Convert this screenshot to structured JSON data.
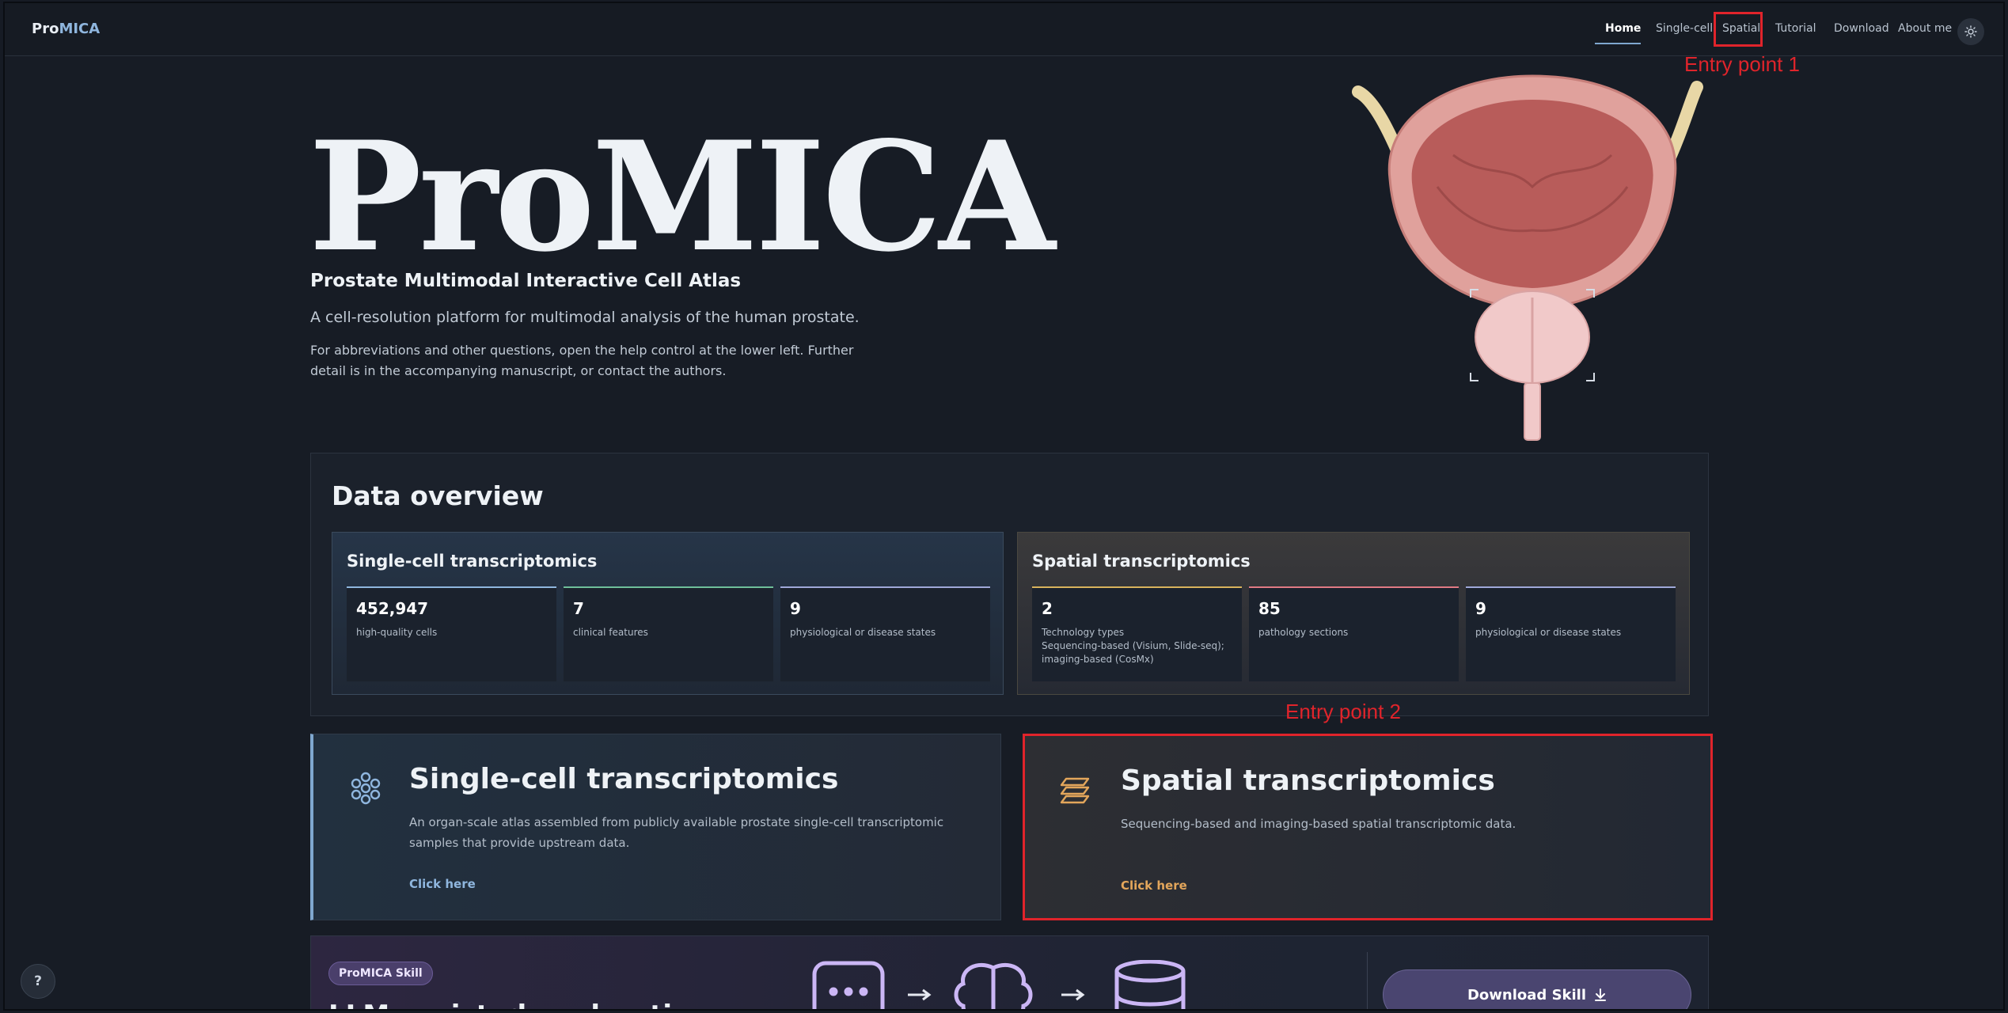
{
  "nav": {
    "brand_pre": "Pro",
    "brand_accent": "MICA",
    "links": [
      "Home",
      "Single-cell",
      "Spatial",
      "Tutorial",
      "Download",
      "About me"
    ]
  },
  "annotations": {
    "entry1": "Entry point 1",
    "entry2": "Entry point 2"
  },
  "hero": {
    "title": "ProMICA",
    "subtitle": "Prostate Multimodal Interactive Cell Atlas",
    "description": "A cell-resolution platform for multimodal analysis of the human prostate.",
    "note": "For abbreviations and other questions, open the help control at the lower left. Further detail is in the accompanying manuscript, or contact the authors."
  },
  "overview": {
    "title": "Data overview",
    "single_cell": {
      "title": "Single-cell transcriptomics",
      "stats": [
        {
          "value": "452,947",
          "label": "high-quality cells"
        },
        {
          "value": "7",
          "label": "clinical features"
        },
        {
          "value": "9",
          "label": "physiological or disease states"
        }
      ]
    },
    "spatial": {
      "title": "Spatial transcriptomics",
      "stats": [
        {
          "value": "2",
          "label": "Technology types",
          "detail": "Sequencing-based (Visium, Slide-seq); imaging-based (CosMx)"
        },
        {
          "value": "85",
          "label": "pathology sections"
        },
        {
          "value": "9",
          "label": "physiological or disease states"
        }
      ]
    }
  },
  "entries": {
    "single_cell": {
      "title": "Single-cell transcriptomics",
      "description": "An organ-scale atlas assembled from publicly available prostate single-cell transcriptomic samples that provide upstream data.",
      "cta": "Click here"
    },
    "spatial": {
      "title": "Spatial transcriptomics",
      "description": "Sequencing-based and imaging-based spatial transcriptomic data.",
      "cta": "Click here"
    }
  },
  "skill": {
    "badge": "ProMICA Skill",
    "title": "LLM-assisted exploration",
    "download_label": "Download Skill"
  },
  "help": {
    "label": "?"
  },
  "colors": {
    "accent_blue": "#8fb6de",
    "accent_orange": "#e3a65b",
    "highlight_red": "#e0242b",
    "stat_line_blue": "#8fb6de",
    "stat_line_green": "#6fbf9a",
    "stat_line_lavender": "#9fa8d8",
    "stat_line_gold": "#d9b35c",
    "stat_line_rose": "#e07a84"
  }
}
